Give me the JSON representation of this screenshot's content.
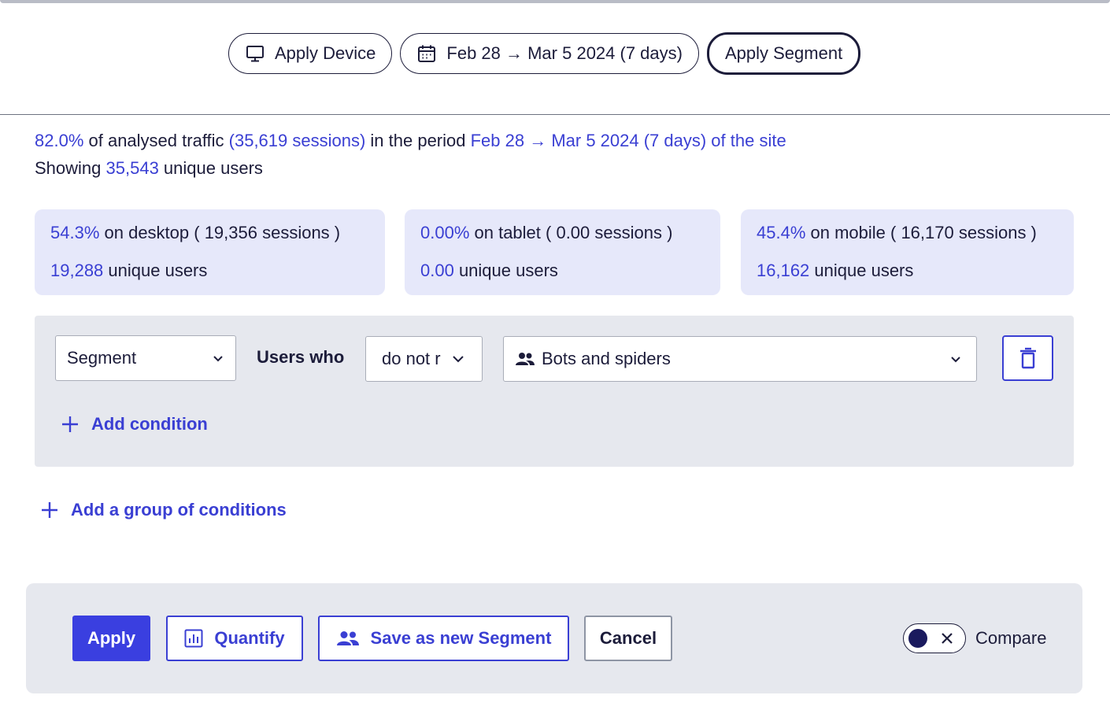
{
  "top_controls": {
    "device_label": "Apply Device",
    "date_label": "Feb 28 → Mar 5 2024 (7 days)",
    "segment_label": "Apply Segment"
  },
  "summary": {
    "pct": "82.0%",
    "text1": " of analysed traffic ",
    "sessions": "(35,619 sessions)",
    "text2": " in the period ",
    "period": "Feb 28 → Mar 5 2024 (7 days) of the site",
    "showing": "Showing ",
    "users": "35,543",
    "users_suffix": " unique users"
  },
  "devices": [
    {
      "pct": "54.3%",
      "label": " on desktop ( 19,356 sessions )",
      "users": "19,288",
      "users_suffix": " unique users"
    },
    {
      "pct": "0.00%",
      "label": " on tablet ( 0.00 sessions )",
      "users": "0.00",
      "users_suffix": " unique users"
    },
    {
      "pct": "45.4%",
      "label": " on mobile ( 16,170 sessions )",
      "users": "16,162",
      "users_suffix": " unique users"
    }
  ],
  "condition": {
    "field": "Segment",
    "users_who": "Users who",
    "operator": "do not r",
    "value": "Bots and spiders",
    "add_condition": "Add condition"
  },
  "add_group": "Add a group of conditions",
  "footer": {
    "apply": "Apply",
    "quantify": "Quantify",
    "save_segment": "Save as new Segment",
    "cancel": "Cancel",
    "compare": "Compare"
  },
  "colors": {
    "accent": "#3a3fd3",
    "card_bg": "#e6e8fa",
    "panel_bg": "#e6e8ee",
    "text": "#1c1c3a"
  }
}
